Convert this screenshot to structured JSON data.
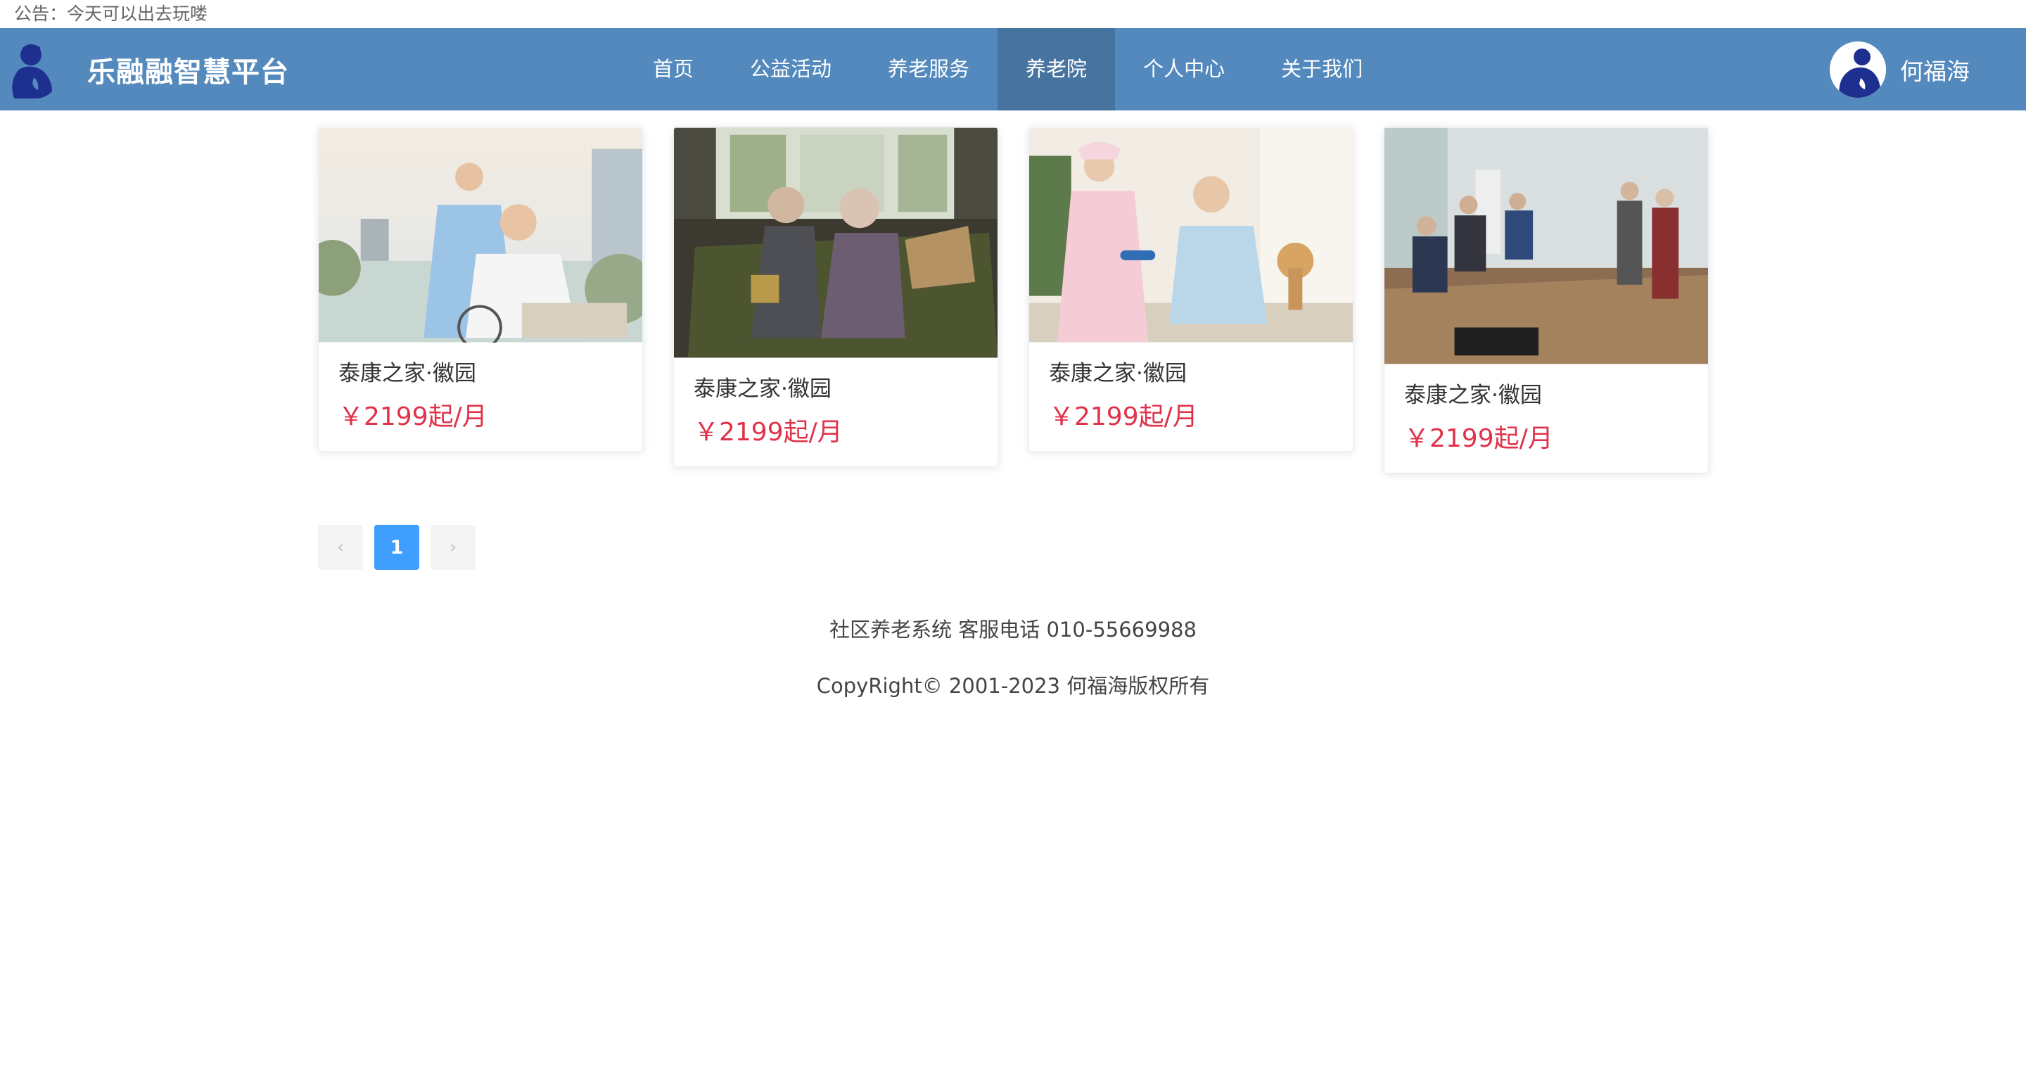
{
  "notice": {
    "text": "公告：今天可以出去玩喽"
  },
  "header": {
    "brand_name": "乐融融智慧平台",
    "nav": [
      "首页",
      "公益活动",
      "养老服务",
      "养老院",
      "个人中心",
      "关于我们"
    ],
    "active_nav": "养老院",
    "user_name": "何福海"
  },
  "cards": [
    {
      "title": "泰康之家·徽园",
      "price": "￥2199起/月"
    },
    {
      "title": "泰康之家·徽园",
      "price": "￥2199起/月"
    },
    {
      "title": "泰康之家·徽园",
      "price": "￥2199起/月"
    },
    {
      "title": "泰康之家·徽园",
      "price": "￥2199起/月"
    }
  ],
  "pagination": {
    "prev": "‹",
    "current": "1",
    "next": "›"
  },
  "footer": {
    "service": "社区养老系统 客服电话 010-55669988",
    "copyright": "CopyRight© 2001-2023 何福海版权所有"
  },
  "colors": {
    "header_bg": "#5389bc",
    "nav_active_bg": "#47739f",
    "price": "#e0324a",
    "pager_active": "#409eff",
    "logo_blue": "#1d2f8f"
  }
}
